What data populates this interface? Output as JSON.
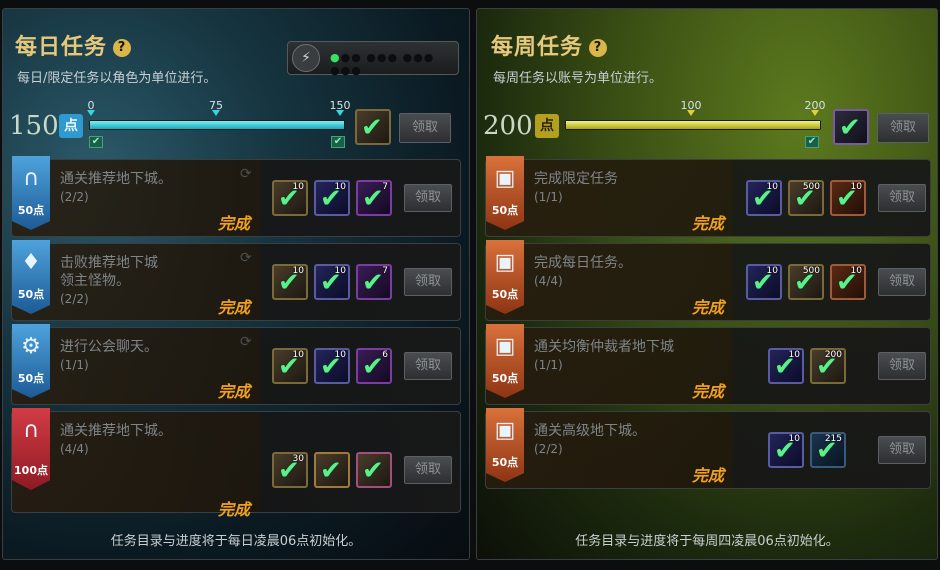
{
  "daily": {
    "title": "每日任务",
    "help": "?",
    "subtitle": "每日/限定任务以角色为单位进行。",
    "points": "150",
    "point_badge": "点",
    "progress": {
      "current": 150,
      "max": 150,
      "milestones": [
        "0",
        "75",
        "150"
      ]
    },
    "claim": "领取",
    "tasks": [
      {
        "points": "50点",
        "name": "通关推荐地下城。",
        "progress": "(2/2)",
        "status": "完成",
        "rewards": [
          "10",
          "10",
          "7"
        ],
        "claim": "领取"
      },
      {
        "points": "50点",
        "name": "击败推荐地下城\n领主怪物。",
        "progress": "(2/2)",
        "status": "完成",
        "rewards": [
          "10",
          "10",
          "7"
        ],
        "claim": "领取"
      },
      {
        "points": "50点",
        "name": "进行公会聊天。",
        "progress": "(1/1)",
        "status": "完成",
        "rewards": [
          "10",
          "10",
          "6"
        ],
        "claim": "领取"
      },
      {
        "points": "100点",
        "name": "通关推荐地下城。",
        "progress": "(4/4)",
        "status": "完成",
        "rewards": [
          "30",
          "",
          ""
        ],
        "claim": "领取"
      }
    ],
    "footer": "任务目录与进度将于每日凌晨06点初始化。"
  },
  "weekly": {
    "title": "每周任务",
    "help": "?",
    "subtitle": "每周任务以账号为单位进行。",
    "points": "200",
    "point_badge": "点",
    "progress": {
      "current": 200,
      "max": 200,
      "milestones": [
        "100",
        "200"
      ]
    },
    "claim": "领取",
    "tasks": [
      {
        "points": "50点",
        "name": "完成限定任务",
        "progress": "(1/1)",
        "status": "完成",
        "rewards": [
          "10",
          "500",
          "10"
        ],
        "claim": "领取"
      },
      {
        "points": "50点",
        "name": "完成每日任务。",
        "progress": "(4/4)",
        "status": "完成",
        "rewards": [
          "10",
          "500",
          "10"
        ],
        "claim": "领取"
      },
      {
        "points": "50点",
        "name": "通关均衡仲裁者地下城",
        "progress": "(1/1)",
        "status": "完成",
        "rewards": [
          "10",
          "200"
        ],
        "claim": "领取"
      },
      {
        "points": "50点",
        "name": "通关高级地下城。",
        "progress": "(2/2)",
        "status": "完成",
        "rewards": [
          "10",
          "215"
        ],
        "claim": "领取"
      }
    ],
    "footer": "任务目录与进度将于每周四凌晨06点初始化。"
  },
  "colors": {
    "gold": "#e6c97a",
    "done": "#f0a020",
    "cyan_bar": "#38d6e0",
    "yellow_bar": "#d8e040"
  }
}
